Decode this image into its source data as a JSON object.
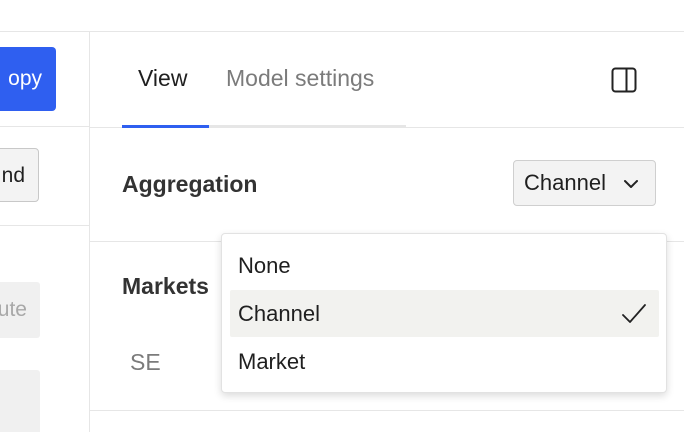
{
  "left": {
    "copy_button": "opy",
    "secondary_button": "nd",
    "disabled_button": "ute"
  },
  "panel": {
    "tabs": [
      {
        "label": "View",
        "active": true
      },
      {
        "label": "Model settings",
        "active": false
      }
    ],
    "panel_toggle_icon": "sidebar-panel-icon",
    "aggregation": {
      "label": "Aggregation",
      "selected": "Channel"
    },
    "markets": {
      "label": "Markets",
      "first_item": "SE"
    }
  },
  "dropdown": {
    "options": [
      {
        "label": "None",
        "selected": false
      },
      {
        "label": "Channel",
        "selected": true
      },
      {
        "label": "Market",
        "selected": false
      }
    ]
  },
  "colors": {
    "accent": "#2f5ff0",
    "highlight": "#f2f2ef"
  }
}
